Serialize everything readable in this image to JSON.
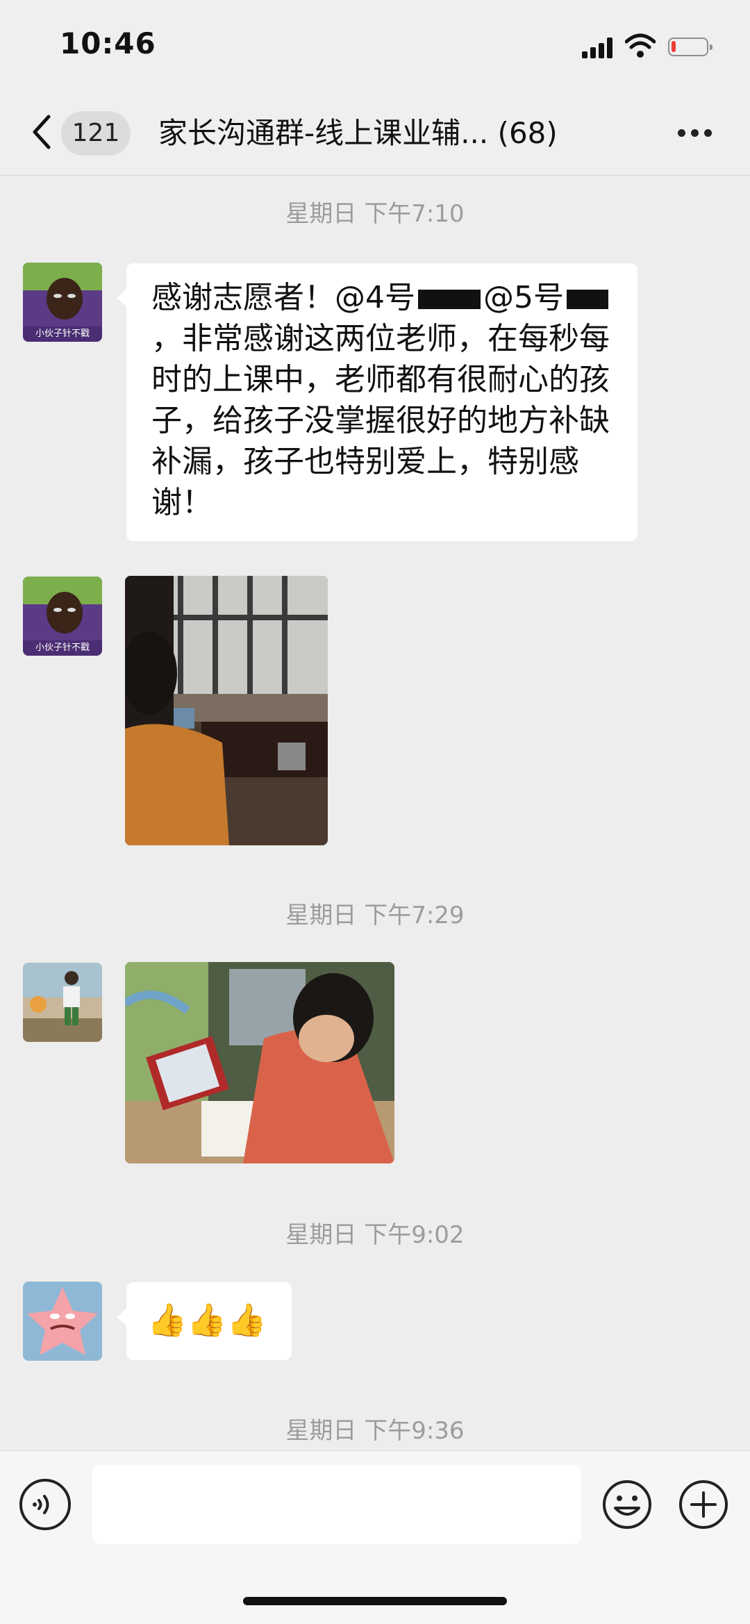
{
  "status_bar": {
    "time": "10:46",
    "battery_level": 0.12
  },
  "header": {
    "back_count": "121",
    "title": "家长沟通群-线上课业辅... (68)"
  },
  "messages": [
    {
      "time": "星期日 下午7:10"
    },
    {
      "text_part1": "感谢志愿者！@4号",
      "text_part2": "@5号",
      "text_part3": "，非常感谢这两位老师，在每秒每时的上课中，老师都有很耐心的孩子，给孩子没掌握很好的地方补缺补漏，孩子也特别爱上，特别感谢！"
    },
    {
      "avatar_caption": "小伙子针不戳"
    },
    {
      "time": "星期日 下午7:29"
    },
    {
      "time": "星期日 下午9:02"
    },
    {
      "emoji": "👍👍👍"
    },
    {
      "time": "星期日 下午9:36"
    }
  ],
  "icons": [
    "chevron-left-icon",
    "more-icon",
    "voice-icon",
    "emoji-icon",
    "plus-icon",
    "signal-icon",
    "wifi-icon",
    "battery-icon"
  ]
}
